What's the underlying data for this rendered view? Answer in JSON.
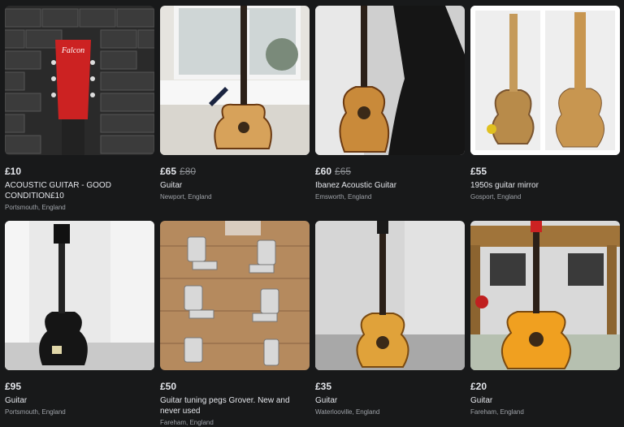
{
  "listings": [
    {
      "price": "£10",
      "old_price": "",
      "title": "ACOUSTIC GUITAR - GOOD CONDITION£10",
      "location": "Portsmouth, England",
      "thumb_text": "Falcon"
    },
    {
      "price": "£65",
      "old_price": "£80",
      "title": "Guitar",
      "location": "Newport, England"
    },
    {
      "price": "£60",
      "old_price": "£65",
      "title": "Ibanez Acoustic Guitar",
      "location": "Emsworth, England"
    },
    {
      "price": "£55",
      "old_price": "",
      "title": "1950s guitar mirror",
      "location": "Gosport, England"
    },
    {
      "price": "£95",
      "old_price": "",
      "title": "Guitar",
      "location": "Portsmouth, England"
    },
    {
      "price": "£50",
      "old_price": "",
      "title": "Guitar tuning pegs Grover. New and never used",
      "location": "Fareham, England"
    },
    {
      "price": "£35",
      "old_price": "",
      "title": "Guitar",
      "location": "Waterlooville, England"
    },
    {
      "price": "£20",
      "old_price": "",
      "title": "Guitar",
      "location": "Fareham, England"
    }
  ]
}
